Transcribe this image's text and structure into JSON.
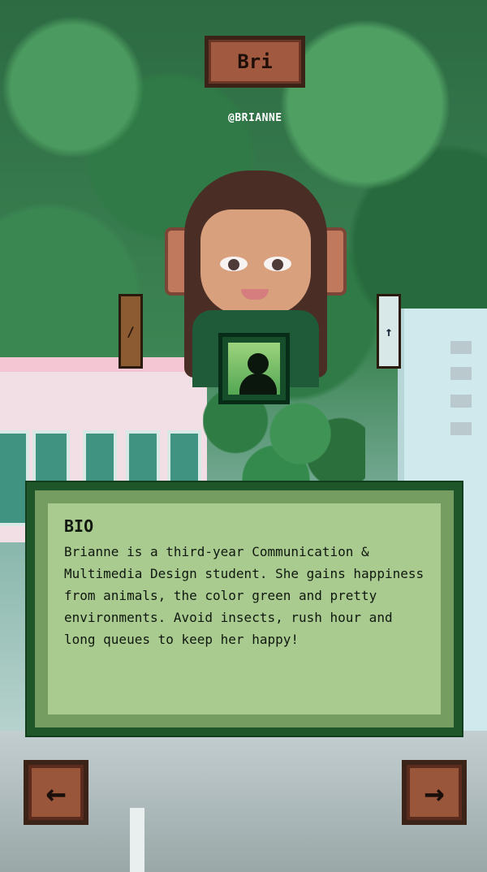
{
  "character": {
    "name": "Bri",
    "handle": "@BRIANNE"
  },
  "bio": {
    "title": "BIO",
    "text": "Brianne is a third-year Communication & Multimedia Design student. She gains happiness from animals, the color green and pretty environments. Avoid insects, rush hour and long queues to keep her happy!"
  },
  "navigation": {
    "previous_label": "←",
    "next_label": "→"
  },
  "icons": {
    "profile": "profile-icon",
    "side_left": "small-card-icon",
    "side_right": "small-card-icon"
  }
}
